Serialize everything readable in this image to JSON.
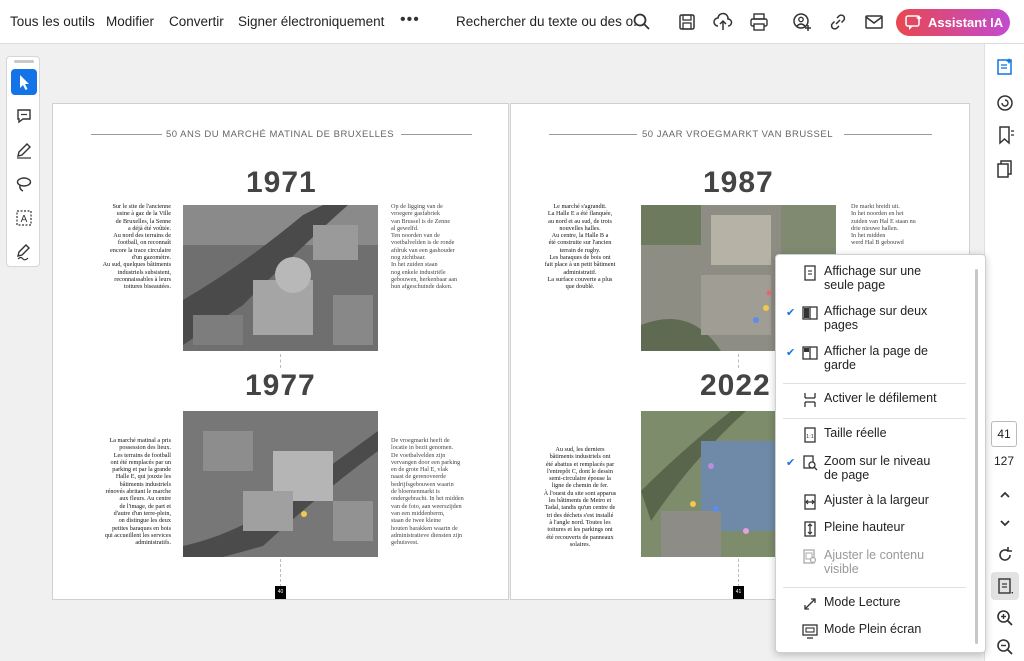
{
  "toolbar": {
    "menu": [
      "Tous les outils",
      "Modifier",
      "Convertir",
      "Signer électroniquement"
    ],
    "more": "•••",
    "search_label": "Rechercher du texte ou des o...",
    "ai_button": "Assistant IA",
    "icons": [
      "search-icon",
      "save-icon",
      "upload-icon",
      "print-icon",
      "add-user-icon",
      "link-icon",
      "mail-icon"
    ]
  },
  "left_tools": [
    "select-cursor-icon",
    "add-comment-icon",
    "draw-icon",
    "lasso-icon",
    "text-select-icon",
    "sign-icon"
  ],
  "right_rail": {
    "icons": [
      "edit-panel-icon",
      "comment-panel-icon",
      "bookmark-panel-icon",
      "pages-panel-icon"
    ],
    "current_page": "41",
    "total_pages": "127",
    "nav_icons": [
      "chevron-up-icon",
      "chevron-down-icon",
      "rotate-icon",
      "page-display-icon",
      "zoom-in-icon",
      "zoom-out-icon"
    ]
  },
  "document": {
    "left": {
      "title": "50 ANS DU MARCHÉ MATINAL DE BRUXELLES",
      "page_number": "40",
      "sections": [
        {
          "year": "1971",
          "text_fr": "Sur le site de l'ancienne\nusine à gaz de la Ville\nde Bruxelles, la Senne\na déjà été voûtée.\nAu nord des terrains de\nfootball, on reconnaît\nencore la trace circulaire\nd'un gazomètre.\nAu sud, quelques bâtiments\nindustriels subsistent,\nreconnaissables à leurs\ntoitures biseautées.",
          "text_nl": "Op de ligging van de\nvroegere gasfabriek\nvan Brussel is de Zenne\nal gewelfd.\nTen noorden van de\nvoetbalvelden is de ronde\nafdruk van een gashouder\nnog zichtbaar.\nIn het zuiden staan\nnog enkele industriële\ngebouwen, herkenbaar aan\nhun afgeschuinde daken."
        },
        {
          "year": "1977",
          "text_fr": "La marché matinal a pris\npossession des lieux.\nLes terrains de football\nont été remplacés par un\nparking et par la grande\nHalle E, qui jouxte les\nbâtiments industriels\nrénovés abritant le marche\naux fleurs. Au centre\nde l'image, de part et\nd'autre d'un terre-plein,\non distingue les deux\npetites baraques en bois\nqui accueillent les services\nadministratifs.",
          "text_nl": "De vroegmarkt heeft de\nlocatie in bezit genomen.\nDe voetbalvelden zijn\nvervangen door een parking\nen de grote Hal E, vlak\nnaast de gerenoveerde\nbedrijfsgebouwen waarin\nde bloemenmarkt is\nondergebracht. In het midden\nvan de foto, aan weerszijden\nvan een middenberm,\nstaan de twee kleine\nhouten barakken waarin de\nadministratieve diensten zijn\ngehuisvest."
        }
      ]
    },
    "right": {
      "title": "50 JAAR VROEGMARKT VAN BRUSSEL",
      "page_number": "41",
      "sections": [
        {
          "year": "1987",
          "text_fr": "Le marché s'agrandit.\nLa Halle E a été flanquée,\nau nord et au sud, de trois\nnouvelles halles.\nAu centre, la Halle B a\nété construite sur l'ancien\nterrain de rugby.\nLes baraques de bois ont\nfait place à un petit bâtiment\nadministratif.\nLa surface couverte a plus\nque doublé.",
          "text_nl": "De markt breidt uit.\nIn het noorden en het\nzuiden van Hal E staan nu\ndrie nieuwe hallen.\nIn het midden\nwerd Hal B gebouwd"
        },
        {
          "year": "2022",
          "text_fr": "Au sud, les derniers\nbâtiments industriels ont\nété abattus et remplacés par\nl'entrepôt C, dont le dessin\nsemi-circulaire épouse la\nligne de chemin de fer.\nÀ l'ouest du site sont apparus\nles bâtiments de Metro et\nTadal, tandis qu'un centre de\ntri des déchets s'est installé\nà l'angle nord. Toutes les\ntoitures et les parkings ont\nété recouverts de panneaux\nsolaires.",
          "text_nl": ""
        }
      ]
    }
  },
  "dropdown": {
    "items": [
      {
        "label": "Affichage sur une\nseule page",
        "icon": "single-page-icon",
        "checked": false,
        "disabled": false
      },
      {
        "label": "Affichage sur deux\npages",
        "icon": "two-page-icon",
        "checked": true,
        "disabled": false
      },
      {
        "label": "Afficher la page de\ngarde",
        "icon": "cover-page-icon",
        "checked": true,
        "disabled": false
      },
      {
        "label": "Activer le défilement",
        "icon": "scroll-icon",
        "checked": false,
        "disabled": false
      },
      {
        "label": "Taille réelle",
        "icon": "actual-size-icon",
        "checked": false,
        "disabled": false
      },
      {
        "label": "Zoom sur le niveau\nde page",
        "icon": "zoom-page-icon",
        "checked": true,
        "disabled": false
      },
      {
        "label": "Ajuster à la largeur",
        "icon": "fit-width-icon",
        "checked": false,
        "disabled": false
      },
      {
        "label": "Pleine hauteur",
        "icon": "full-height-icon",
        "checked": false,
        "disabled": false
      },
      {
        "label": "Ajuster le contenu\nvisible",
        "icon": "fit-visible-icon",
        "checked": false,
        "disabled": true
      },
      {
        "label": "Mode Lecture",
        "icon": "read-mode-icon",
        "checked": false,
        "disabled": false
      },
      {
        "label": "Mode Plein écran",
        "icon": "fullscreen-icon",
        "checked": false,
        "disabled": false
      }
    ],
    "check_glyph": "✔"
  },
  "colors": {
    "accent": "#1473e6",
    "ai_gradient_start": "#e8484f",
    "ai_gradient_end": "#c24bd0"
  }
}
